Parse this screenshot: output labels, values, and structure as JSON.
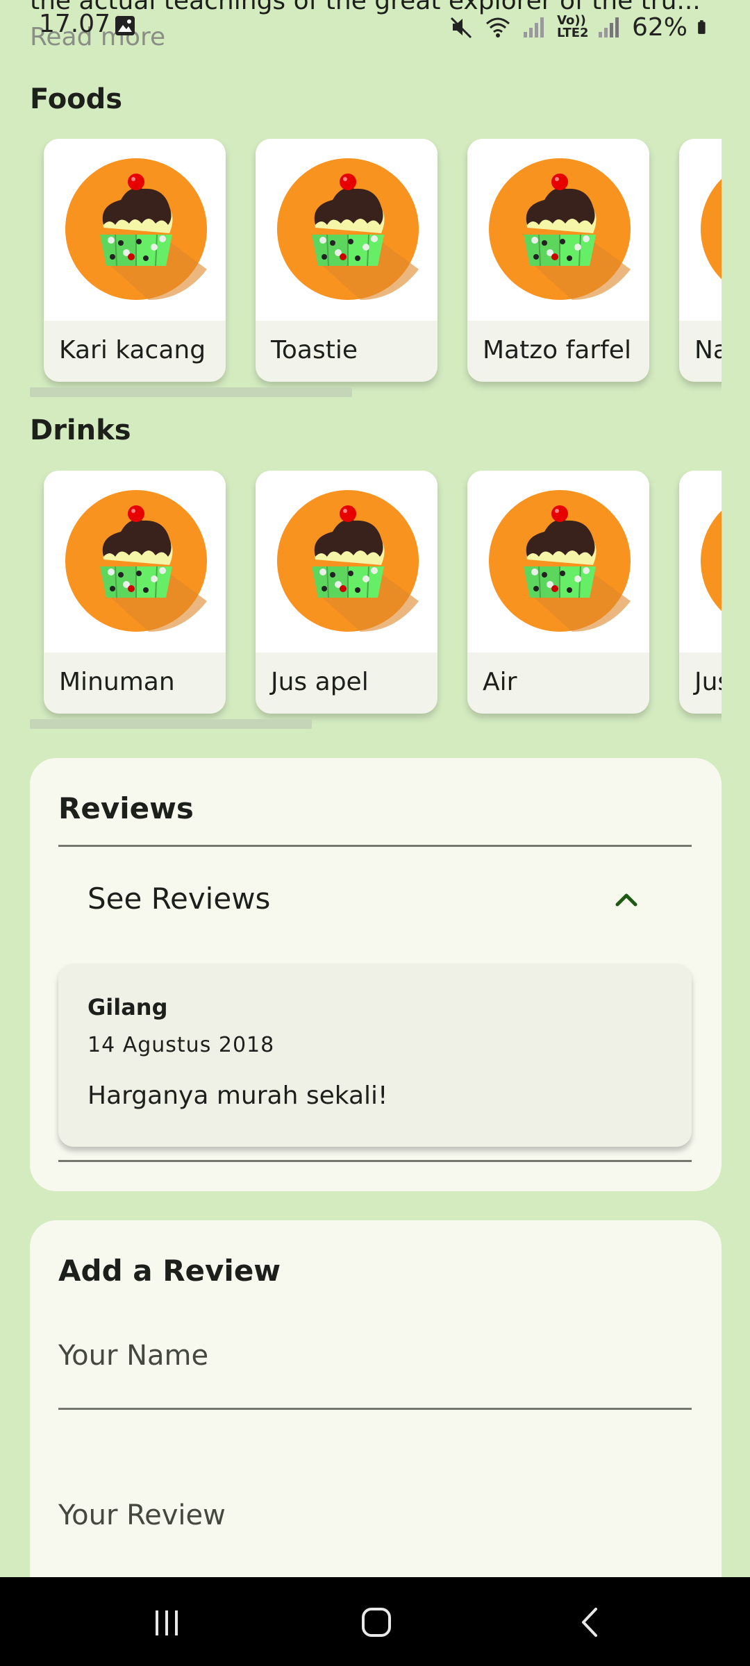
{
  "header": {
    "clipped_description": "the actual teachings of the great explorer of the tru...",
    "read_more": "Read more"
  },
  "status_bar": {
    "time": "17.07",
    "volte": "Vo)) LTE2",
    "battery": "62%"
  },
  "foods": {
    "title": "Foods",
    "items": [
      "Kari kacang",
      "Toastie",
      "Matzo farfel",
      "Na"
    ]
  },
  "drinks": {
    "title": "Drinks",
    "items": [
      "Minuman",
      "Jus apel",
      "Air",
      "Jus"
    ]
  },
  "reviews": {
    "title": "Reviews",
    "see_reviews": "See Reviews",
    "list": [
      {
        "name": "Gilang",
        "date": "14 Agustus 2018",
        "text": "Harganya murah sekali!"
      }
    ]
  },
  "add_review": {
    "title": "Add a Review",
    "name_placeholder": "Your Name",
    "review_placeholder": "Your Review"
  },
  "icons": {
    "food_thumb": "cupcake-icon",
    "collapse": "chevron-up-icon",
    "nav_recents": "recents-icon",
    "nav_home": "home-icon",
    "nav_back": "back-icon"
  },
  "colors": {
    "background": "#d4ebc0",
    "panel": "#f7f8ee",
    "accent": "#1e5a14"
  }
}
